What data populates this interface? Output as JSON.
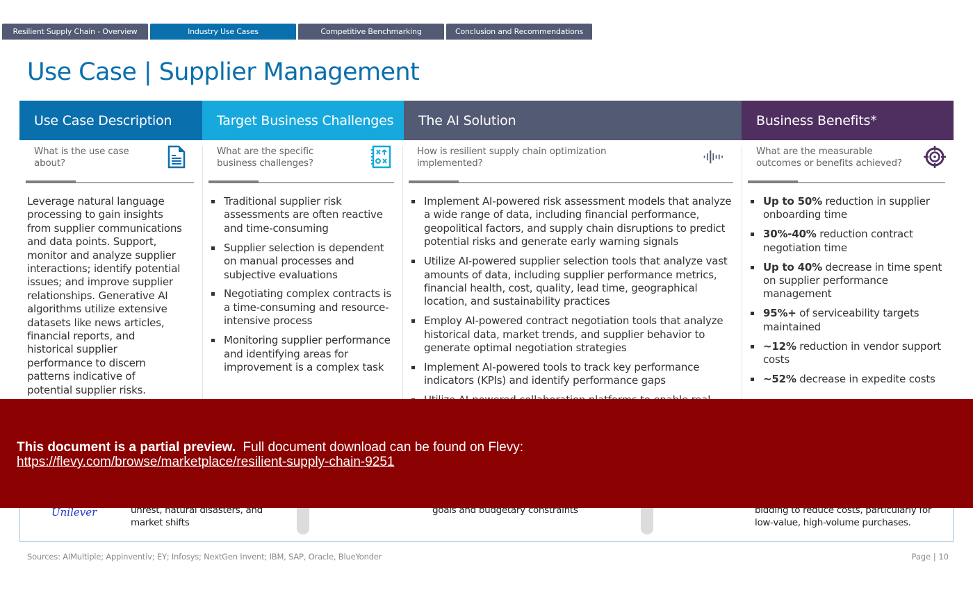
{
  "nav": {
    "tabs": [
      {
        "label": "Resilient Supply Chain - Overview",
        "active": false
      },
      {
        "label": "Industry Use Cases",
        "active": true
      },
      {
        "label": "Competitive Benchmarking",
        "active": false
      },
      {
        "label": "Conclusion and Recommendations",
        "active": false
      }
    ]
  },
  "page": {
    "title": "Use Case | Supplier Management"
  },
  "columns": [
    {
      "header": "Use Case Description",
      "subheading": "What is the use case about?",
      "icon": "document-icon",
      "body": "Leverage natural language processing to gain insights from supplier communications and data points. Support, monitor and analyze supplier interactions; identify potential issues; and improve supplier relationships. Generative AI algorithms utilize extensive datasets like news articles, financial reports, and historical supplier performance to discern patterns indicative of potential supplier risks."
    },
    {
      "header": "Target Business Challenges",
      "subheading": "What are the specific business challenges?",
      "icon": "strategy-notebook-icon",
      "bullets": [
        "Traditional supplier risk assessments are often reactive and time-consuming",
        "Supplier selection is dependent on  manual processes and subjective evaluations",
        "Negotiating complex contracts is a time-consuming and resource-intensive process",
        "Monitoring supplier performance and identifying areas for improvement is a complex task"
      ]
    },
    {
      "header": "The AI Solution",
      "subheading": "How is resilient supply chain optimization implemented?",
      "icon": "sound-wave-icon",
      "bullets": [
        "Implement AI-powered risk assessment models that analyze a wide range of data, including financial performance, geopolitical factors, and supply chain disruptions to predict potential risks and generate early warning signals",
        "Utilize AI-powered supplier selection tools that analyze vast amounts of data, including supplier performance metrics, financial health, cost, quality, lead time, geographical location, and sustainability practices",
        "Employ AI-powered contract negotiation tools that analyze historical data, market trends, and supplier behavior to generate optimal negotiation strategies",
        "Implement AI-powered tools to track key performance indicators (KPIs) and identify performance gaps",
        "Utilize AI-powered collaboration platforms to enable real-time"
      ]
    },
    {
      "header": "Business Benefits*",
      "subheading": "What are the measurable outcomes or benefits achieved?",
      "icon": "target-icon",
      "benefits": [
        {
          "bold": "Up to 50%",
          "text": " reduction in supplier onboarding time"
        },
        {
          "bold": "30%-40%",
          "text": " reduction contract negotiation time"
        },
        {
          "bold": "Up to 40%",
          "text": " decrease in time spent on supplier performance management"
        },
        {
          "bold": "95%+",
          "text": " of serviceability targets maintained"
        },
        {
          "bold": "~12%",
          "text": " reduction in vendor support costs"
        },
        {
          "bold": "~52%",
          "text": " decrease in expedite costs"
        }
      ]
    }
  ],
  "case_strip": {
    "logo": "Unilever",
    "text1": "unrest, natural disasters, and market shifts",
    "text2": "goals and budgetary constraints",
    "text3": "bidding to reduce costs, particularly for low-value, high-volume purchases."
  },
  "footer": {
    "sources": "Sources: AIMultiple; Appinventiv; EY; Infosys; NextGen Invent; IBM, SAP, Oracle, BlueYonder",
    "page": "Page | 10"
  },
  "banner": {
    "bold": "This document is a partial preview.",
    "text": "  Full document download can be found on Flevy:",
    "link": "https://flevy.com/browse/marketplace/resilient-supply-chain-9251"
  }
}
